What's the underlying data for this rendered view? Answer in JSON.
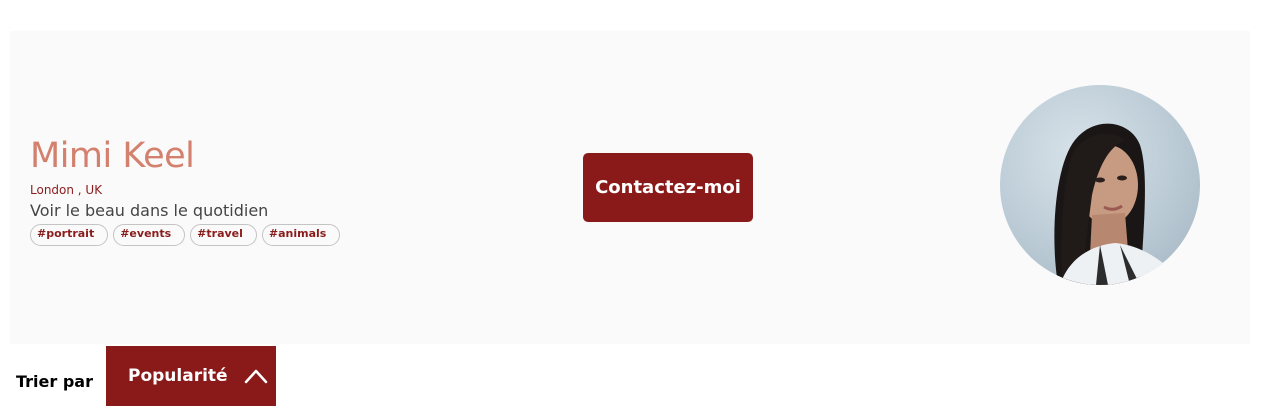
{
  "photographer": {
    "name": "Mimi Keel",
    "location": "London , UK",
    "tagline": "Voir le beau dans le quotidien",
    "tags": [
      "#portrait",
      "#events",
      "#travel",
      "#animals"
    ]
  },
  "contact": {
    "label": "Contactez-moi"
  },
  "sort": {
    "label": "Trier par",
    "selected": "Popularité"
  },
  "icons": {
    "sort_toggle": "chevron-up-icon"
  },
  "colors": {
    "brand": "#8a1a1a",
    "name": "#d3806e",
    "card_background": "#fafafa"
  }
}
